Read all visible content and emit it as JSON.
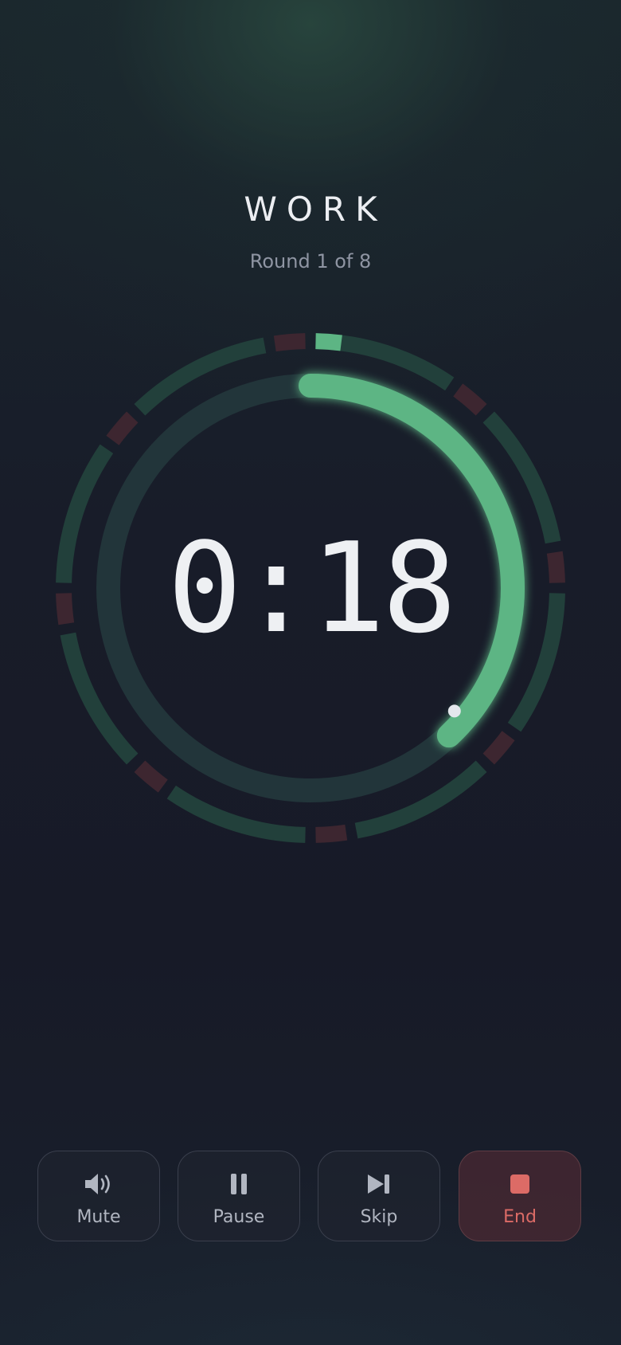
{
  "phase": {
    "label": "WORK",
    "round_text": "Round 1 of 8",
    "time_remaining": "0:18",
    "progress_remaining_fraction": 0.38,
    "current_interval_index": 0
  },
  "intervals": [
    {
      "type": "work"
    },
    {
      "type": "rest"
    },
    {
      "type": "work"
    },
    {
      "type": "rest"
    },
    {
      "type": "work"
    },
    {
      "type": "rest"
    },
    {
      "type": "work"
    },
    {
      "type": "rest"
    },
    {
      "type": "work"
    },
    {
      "type": "rest"
    },
    {
      "type": "work"
    },
    {
      "type": "rest"
    },
    {
      "type": "work"
    },
    {
      "type": "rest"
    },
    {
      "type": "work"
    },
    {
      "type": "rest"
    }
  ],
  "controls": {
    "mute": {
      "label": "Mute",
      "icon": "speaker-icon"
    },
    "pause": {
      "label": "Pause",
      "icon": "pause-icon"
    },
    "skip": {
      "label": "Skip",
      "icon": "skip-forward-icon"
    },
    "end": {
      "label": "End",
      "icon": "stop-icon"
    }
  },
  "colors": {
    "accent_work": "#5db584",
    "work_track": "#22403b",
    "rest_track": "#3d2630",
    "progress_track": "#22353a",
    "end_accent": "#dc6b66"
  }
}
